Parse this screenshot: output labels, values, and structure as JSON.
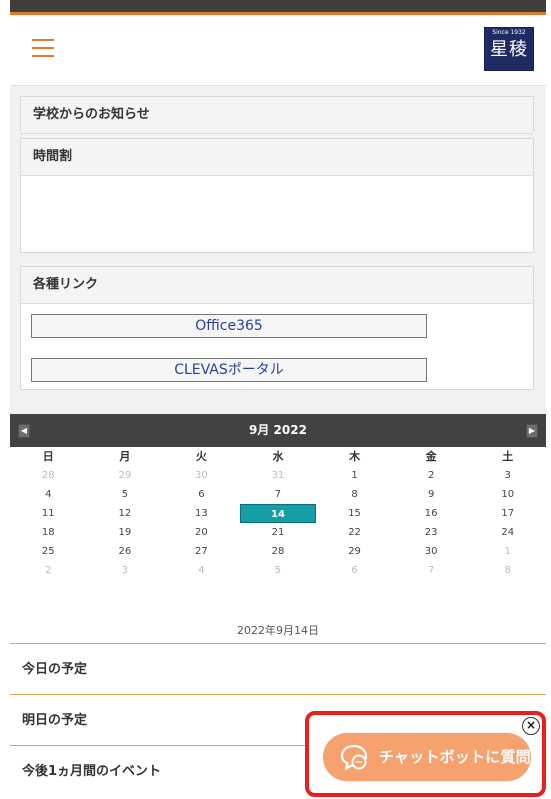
{
  "header": {
    "logo_small": "Since 1932",
    "logo_main": "星稜"
  },
  "sections": {
    "announcements": "学校からのお知らせ",
    "timetable": "時間割",
    "links_title": "各種リンク",
    "links": [
      "Office365",
      "CLEVASポータル"
    ]
  },
  "calendar": {
    "month_label": "9月 2022",
    "prev_icon": "◀",
    "next_icon": "▶",
    "weekdays": [
      "日",
      "月",
      "火",
      "水",
      "木",
      "金",
      "土"
    ],
    "weeks": [
      [
        "28",
        "29",
        "30",
        "31",
        "1",
        "2",
        "3"
      ],
      [
        "4",
        "5",
        "6",
        "7",
        "8",
        "9",
        "10"
      ],
      [
        "11",
        "12",
        "13",
        "14",
        "15",
        "16",
        "17"
      ],
      [
        "18",
        "19",
        "20",
        "21",
        "22",
        "23",
        "24"
      ],
      [
        "25",
        "26",
        "27",
        "28",
        "29",
        "30",
        "1"
      ],
      [
        "2",
        "3",
        "4",
        "5",
        "6",
        "7",
        "8"
      ]
    ],
    "selected_day": "14",
    "selected_date_text": "2022年9月14日"
  },
  "events": {
    "today": "今日の予定",
    "tomorrow": "明日の予定",
    "month": "今後1ヵ月間のイベント"
  },
  "chatbot": {
    "close": "×",
    "label": "チャットボットに質問",
    "icon": "speech-bubble-icon"
  },
  "colors": {
    "accent": "#e47b2a",
    "calendar_selected": "#159ea7",
    "chat_button": "#f6a26f",
    "highlight_border": "#e61f1f"
  }
}
